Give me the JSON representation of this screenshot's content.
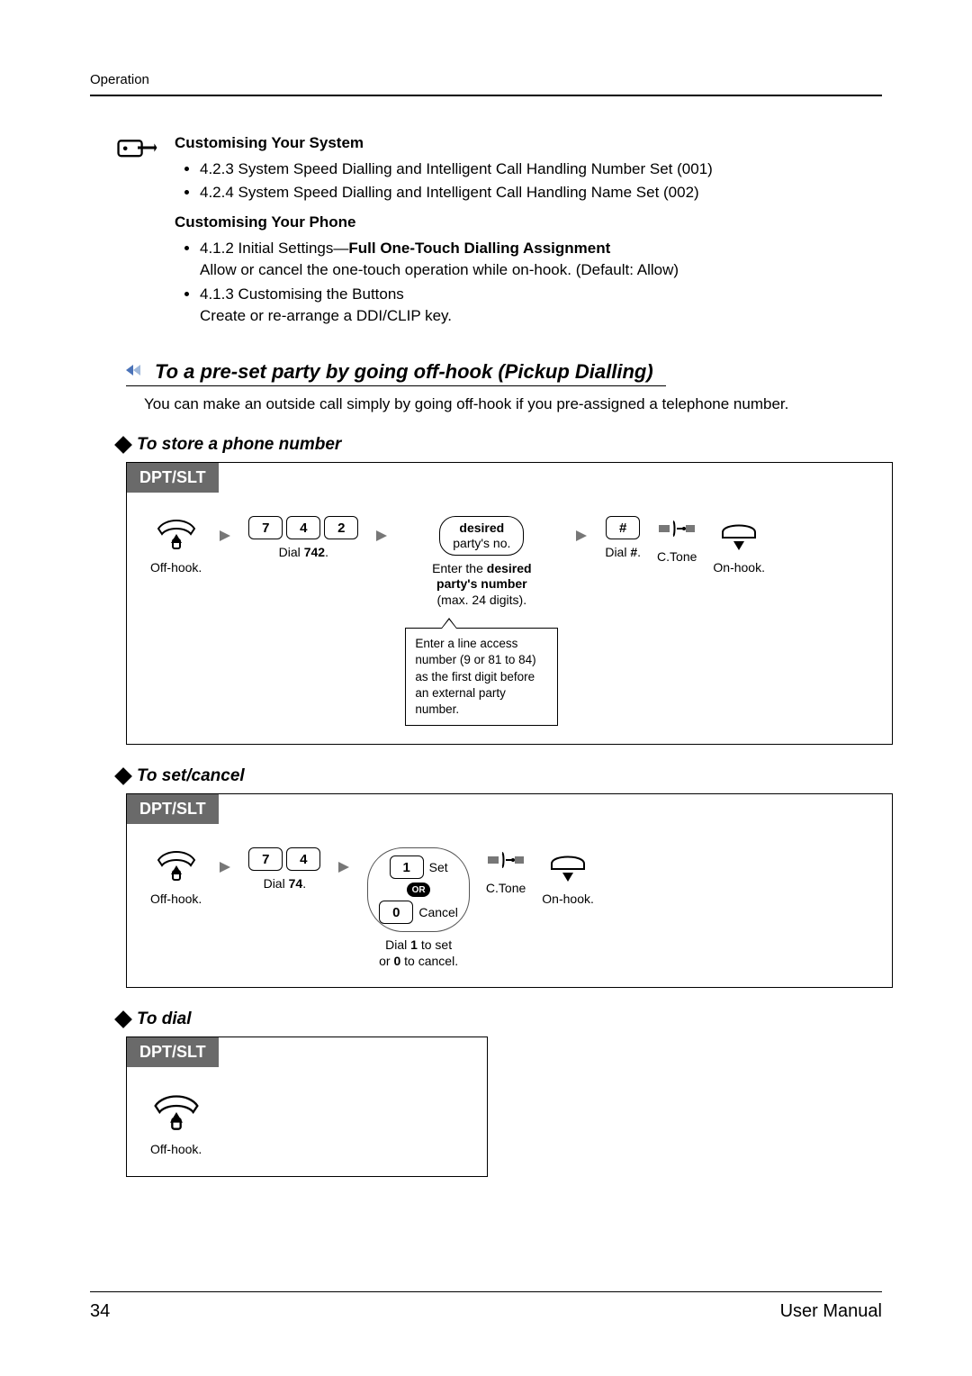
{
  "header": {
    "running": "Operation"
  },
  "notes": {
    "title_system": "Customising Your System",
    "items_system": [
      "4.2.3   System Speed Dialling and Intelligent Call Handling Number Set (001)",
      "4.2.4   System Speed Dialling and Intelligent Call Handling Name Set (002)"
    ],
    "title_phone": "Customising Your Phone",
    "item_phone_1a": "4.1.2   Initial Settings—",
    "item_phone_1b": "Full One-Touch Dialling Assignment",
    "item_phone_1_desc": "Allow or cancel the one-touch operation while on-hook. (Default: Allow)",
    "item_phone_2": "4.1.3   Customising the Buttons",
    "item_phone_2_desc": "Create or re-arrange a DDI/CLIP key."
  },
  "section": {
    "heading": "To a pre-set party by going off-hook (Pickup Dialling)",
    "desc": "You can make an outside call simply by going off-hook if you pre-assigned a telephone number."
  },
  "sub": {
    "store": "To store a phone number",
    "setcancel": "To set/cancel",
    "dial": "To dial"
  },
  "proc_labels": {
    "dpt_slt": "DPT/SLT"
  },
  "store": {
    "offhook": "Off-hook.",
    "dial742": "Dial 742.",
    "k7": "7",
    "k4": "4",
    "k2": "2",
    "oval_line1": "desired",
    "oval_line2": "party's no.",
    "enter_a": "Enter the ",
    "enter_b": "desired",
    "enter_c": "party's number",
    "enter_d": "(max. 24 digits).",
    "hash": "#",
    "dialhash": "Dial #.",
    "ctone": "C.Tone",
    "onhook": "On-hook.",
    "callout": "Enter a line access number (9 or 81 to 84) as the first digit before an external party number."
  },
  "setc": {
    "offhook": "Off-hook.",
    "k7": "7",
    "k4": "4",
    "dial74": "Dial 74.",
    "k1": "1",
    "set": "Set",
    "or": "OR",
    "k0": "0",
    "cancel": "Cancel",
    "dial_desc_a": "Dial ",
    "dial_desc_b": "1",
    "dial_desc_c": " to set",
    "dial_desc_d": "or ",
    "dial_desc_e": "0",
    "dial_desc_f": " to cancel.",
    "ctone": "C.Tone",
    "onhook": "On-hook."
  },
  "dial": {
    "offhook": "Off-hook."
  },
  "footer": {
    "page": "34",
    "title": "User Manual"
  }
}
